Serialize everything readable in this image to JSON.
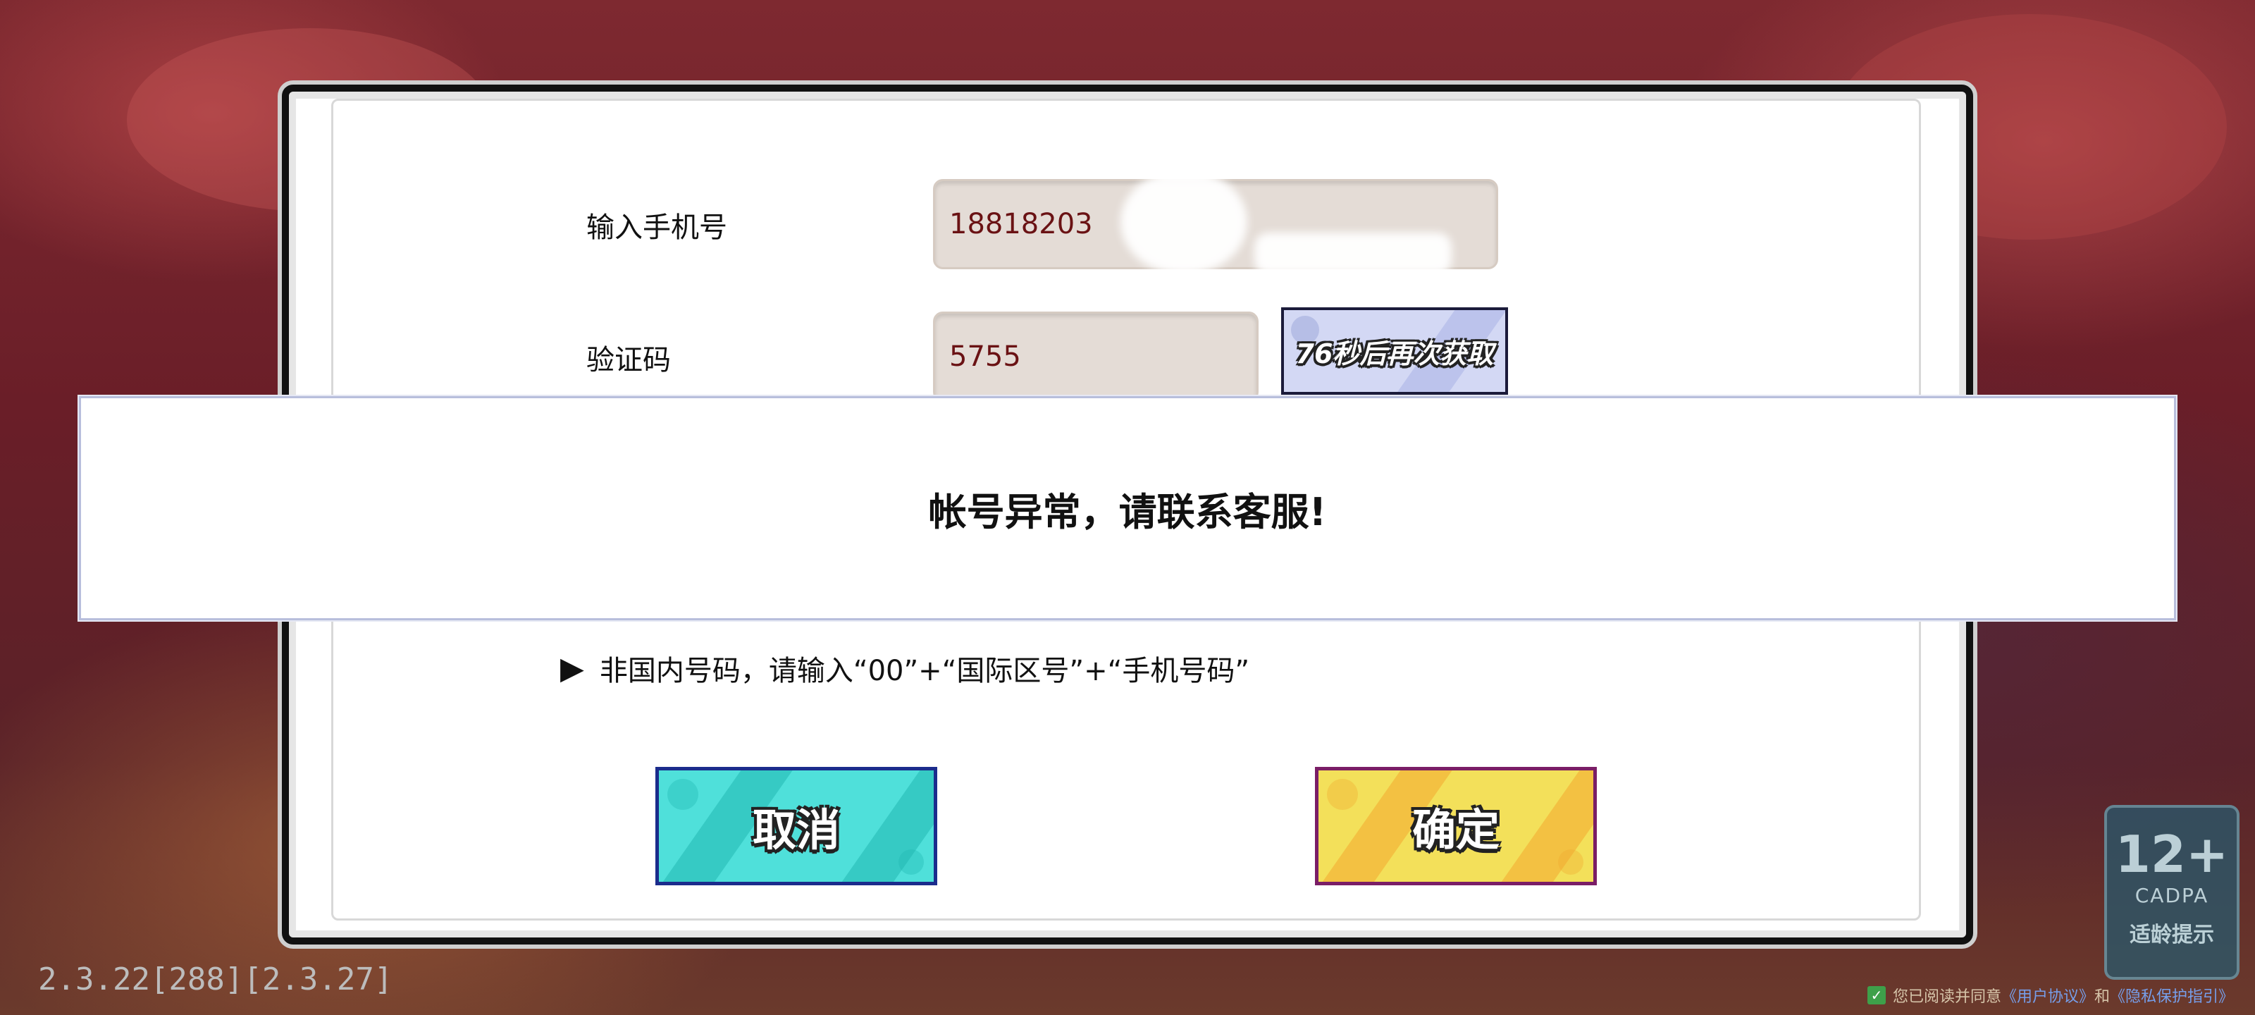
{
  "form": {
    "phone_label": "输入手机号",
    "phone_value": "18818203",
    "code_label": "验证码",
    "code_value": "5755",
    "resend_label": "76秒后再次获取",
    "hint_text": "非国内号码，请输入“00”+“国际区号”+“手机号码”"
  },
  "modal": {
    "message": "帐号异常，请联系客服!"
  },
  "buttons": {
    "cancel_label": "取消",
    "confirm_label": "确定"
  },
  "version": "2.3.22[288][2.3.27]",
  "age_rating": {
    "number": "12+",
    "org": "CADPA",
    "tip": "适龄提示"
  },
  "agreement": {
    "prefix": "您已阅读并同意",
    "user_agreement": "《用户协议》",
    "and": "和",
    "privacy": "《隐私保护指引》"
  },
  "colors": {
    "cancel_bg": "#4fe0da",
    "confirm_bg": "#f3e05a",
    "field_bg": "#e4dcd6",
    "field_text": "#6a1214"
  }
}
